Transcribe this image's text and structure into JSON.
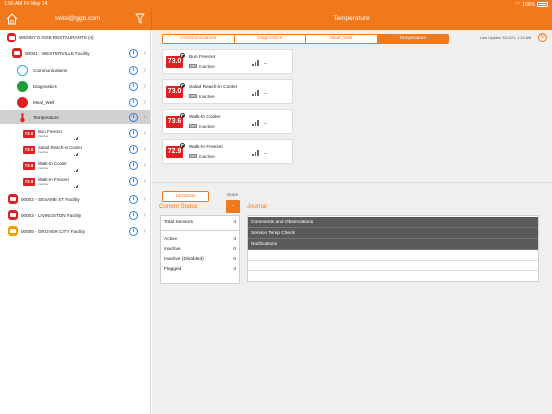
{
  "status_bar": {
    "time": "1:56 AM",
    "date": "Fri May 14",
    "battery": "100%"
  },
  "nav": {
    "user": "swisl@ggb.com",
    "title": "Temperature"
  },
  "sidebar": {
    "root_label": "WENDY'S GGB RESTAURANTS (4)",
    "facility_1": "00001 - WESTERVILLE Facility",
    "comm": "Communications",
    "diag": "Diagnostics",
    "meal": "Meal_Well",
    "temp": "Temperature",
    "minis": [
      {
        "temp": "73.0",
        "name": "Bun Freezer",
        "sub": "Inactive"
      },
      {
        "temp": "73.0",
        "name": "Salad Reach-in Cooler",
        "sub": "Inactive"
      },
      {
        "temp": "73.6",
        "name": "Walk-In Cooler",
        "sub": "Inactive"
      },
      {
        "temp": "72.9",
        "name": "Walk-In Freezer",
        "sub": "Inactive"
      }
    ],
    "facility_2": "00002 - SESAME ST Facility",
    "facility_3": "00003 - LIVINGSTON Facility",
    "facility_5": "00005 - GROVER CITY Facility"
  },
  "tabs": [
    "Communications",
    "Diagnostics",
    "Meal_Well",
    "Temperature"
  ],
  "last_update": "Last Update: 5/14/21, 1:24 AM",
  "cards": [
    {
      "temp": "73.0",
      "name": "Bun Freezer",
      "badge": "SBS",
      "status": "Inactive",
      "value": "--"
    },
    {
      "temp": "73.0",
      "name": "Salad Reach-in Cooler",
      "badge": "SBS",
      "status": "Inactive",
      "value": "--"
    },
    {
      "temp": "73.6",
      "name": "Walk-In Cooler",
      "badge": "SBS",
      "status": "Inactive",
      "value": "--"
    },
    {
      "temp": "72.9",
      "name": "Walk-In Freezer",
      "badge": "SBS",
      "status": "Inactive",
      "value": "--"
    }
  ],
  "legend_label": "LEGEND",
  "score_label": "Score",
  "score_value": "-",
  "current_status": {
    "heading": "Current Status",
    "rows": [
      {
        "label": "Total Sensors",
        "value": "4"
      },
      {
        "label": "Active",
        "value": "4"
      },
      {
        "label": "Inactive",
        "value": "0"
      },
      {
        "label": "Inactive (Disabled)",
        "value": "0"
      },
      {
        "label": "Flagged",
        "value": "4"
      }
    ]
  },
  "journal": {
    "heading": "Journal",
    "items": [
      "Comments and Observations",
      "Service Temp Check",
      "Notifications"
    ]
  },
  "colors": {
    "accent": "#f0791b",
    "alert_red": "#e02020",
    "info_blue": "#2f7fd8"
  }
}
